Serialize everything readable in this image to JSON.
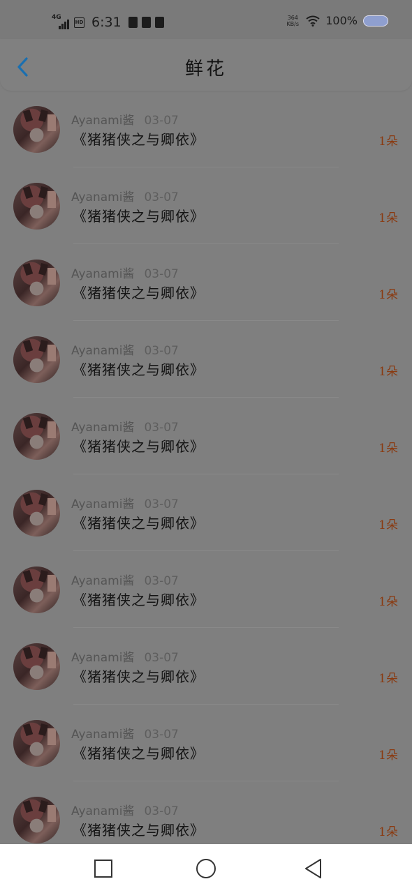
{
  "status_bar": {
    "network": "4G",
    "hd": "HD",
    "time": "6:31",
    "speed_value": "364",
    "speed_unit": "KB/s",
    "battery": "100%",
    "battery_color": "#8f9fcf"
  },
  "header": {
    "back_icon": "chevron-left-icon",
    "back_color": "#1a6fb0",
    "title": "鲜花"
  },
  "items": [
    {
      "user": "Ayanami酱",
      "date": "03-07",
      "book": "《猪猪侠之与卿依》",
      "count": "1朵"
    },
    {
      "user": "Ayanami酱",
      "date": "03-07",
      "book": "《猪猪侠之与卿依》",
      "count": "1朵"
    },
    {
      "user": "Ayanami酱",
      "date": "03-07",
      "book": "《猪猪侠之与卿依》",
      "count": "1朵"
    },
    {
      "user": "Ayanami酱",
      "date": "03-07",
      "book": "《猪猪侠之与卿依》",
      "count": "1朵"
    },
    {
      "user": "Ayanami酱",
      "date": "03-07",
      "book": "《猪猪侠之与卿依》",
      "count": "1朵"
    },
    {
      "user": "Ayanami酱",
      "date": "03-07",
      "book": "《猪猪侠之与卿依》",
      "count": "1朵"
    },
    {
      "user": "Ayanami酱",
      "date": "03-07",
      "book": "《猪猪侠之与卿依》",
      "count": "1朵"
    },
    {
      "user": "Ayanami酱",
      "date": "03-07",
      "book": "《猪猪侠之与卿依》",
      "count": "1朵"
    },
    {
      "user": "Ayanami酱",
      "date": "03-07",
      "book": "《猪猪侠之与卿依》",
      "count": "1朵"
    },
    {
      "user": "Ayanami酱",
      "date": "03-07",
      "book": "《猪猪侠之与卿依》",
      "count": "1朵"
    }
  ],
  "navbar": {
    "recent_icon": "square-icon",
    "home_icon": "circle-icon",
    "back_icon": "triangle-back-icon"
  }
}
